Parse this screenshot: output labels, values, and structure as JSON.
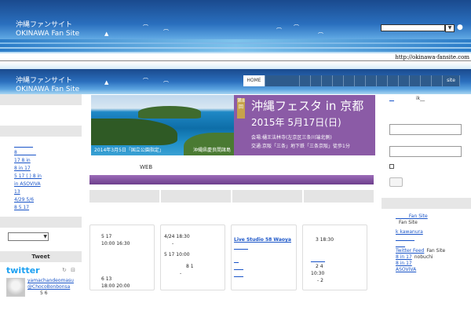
{
  "header1": {
    "site_title_jp": "沖縄ファンサイト",
    "site_title_en": "OKINAWA Fan Site",
    "search_placeholder": "",
    "submit_glyph": "●"
  },
  "url": "http://okinawa-fansite.com",
  "header2": {
    "site_title_jp": "沖縄ファンサイト",
    "site_title_en": "OKINAWA Fan Site"
  },
  "nav": {
    "home": "HOME",
    "last": "site"
  },
  "left": {
    "links": [
      "________",
      "8________",
      "17    8      in",
      "8      in      17",
      "5 17 ( ) 8      in",
      "in      ASOVIVA",
      "13",
      "4/29 5/6",
      "8      5 17"
    ],
    "twitter_header": "Tweet",
    "twitter_logo": "twitter",
    "twitter_icons": [
      "↻",
      "⊟"
    ],
    "tweet_user": "yamachandeomasu",
    "tweet_mention": "@ChocoBonbonsa",
    "tweet_text": "5 6"
  },
  "banner": {
    "photo_caption": "2014年3月5日「国立公園指定」",
    "photo_place": "沖縄県慶良間諸島",
    "edition": "第8回",
    "festa_name": "沖縄フェスタ in 京都",
    "festa_date": "2015年  5月17日(日)",
    "venue": "会場:樋王法林寺(左京区三条川端北側)",
    "access": "交通:京阪「三条」地下鉄「三条京阪」徒歩1分"
  },
  "main": {
    "web_label": "WEB",
    "cards": [
      {
        "lines": [
          "5 17",
          "10:00 16:30",
          "",
          "",
          "",
          "6 13",
          "18:00 20:00"
        ]
      },
      {
        "lines": [
          "4/24    18:30",
          "-",
          "",
          "5 17    10:00",
          "",
          "8 1",
          "-"
        ]
      },
      {
        "title": "Live Studio 58 Waoya",
        "link1": "______",
        "links": [
          "__",
          "____",
          "____"
        ]
      },
      {
        "lines": [
          "3    18:30",
          "",
          "",
          "",
          "2 4",
          "10:30",
          "-    2"
        ],
        "link": "______"
      }
    ]
  },
  "right": {
    "top_text": "ik__",
    "links": [
      "_____ Fan Site",
      "Fan Site",
      "k kawanura",
      "________",
      "____",
      "Twitter Feed",
      "8      in      17",
      "8      in      17",
      "ASOVIVA"
    ],
    "fan_site": "Fan Site",
    "nobuchi": "nobuchi"
  }
}
